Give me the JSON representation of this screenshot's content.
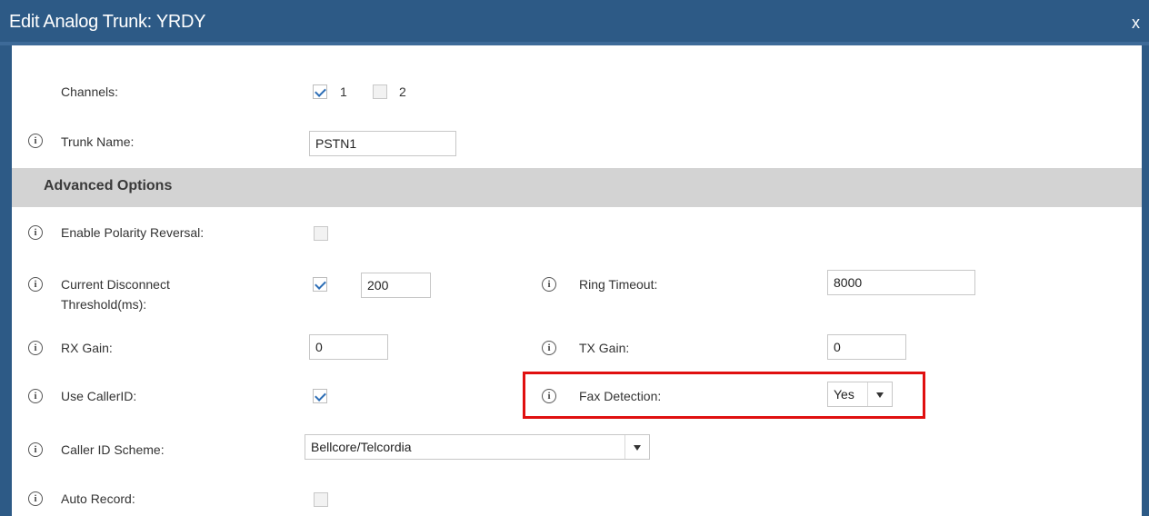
{
  "dialog": {
    "title": "Edit Analog Trunk: YRDY",
    "close_label": "x"
  },
  "fields": {
    "channels": {
      "label": "Channels:",
      "options": [
        {
          "label": "1",
          "checked": true
        },
        {
          "label": "2",
          "checked": false
        }
      ]
    },
    "trunk_name": {
      "label": "Trunk Name:",
      "value": "PSTN1"
    },
    "advanced_options": {
      "label": "Advanced Options"
    },
    "polarity_reversal": {
      "label": "Enable Polarity Reversal:",
      "checked": false
    },
    "disconnect_threshold": {
      "label_line1": "Current Disconnect",
      "label_line2": "Threshold(ms):",
      "checked": true,
      "value": "200"
    },
    "ring_timeout": {
      "label": "Ring Timeout:",
      "value": "8000"
    },
    "rx_gain": {
      "label": "RX Gain:",
      "value": "0"
    },
    "tx_gain": {
      "label": "TX Gain:",
      "value": "0"
    },
    "use_callerid": {
      "label": "Use CallerID:",
      "checked": true
    },
    "fax_detection": {
      "label": "Fax Detection:",
      "value": "Yes"
    },
    "callerid_scheme": {
      "label": "Caller ID Scheme:",
      "value": "Bellcore/Telcordia"
    },
    "auto_record": {
      "label": "Auto Record:",
      "checked": false
    }
  },
  "icons": {
    "info": "i"
  },
  "colors": {
    "titlebar": "#2d5a86",
    "highlight": "#e01010",
    "check": "#2d6eb6",
    "section": "#d3d3d3"
  }
}
